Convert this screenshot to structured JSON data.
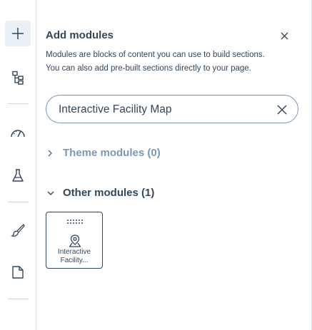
{
  "rail": {
    "items": [
      {
        "icon": "plus-icon"
      },
      {
        "icon": "tree-structure-icon"
      },
      {
        "icon": "gauge-icon"
      },
      {
        "icon": "flask-icon"
      },
      {
        "icon": "brush-icon"
      },
      {
        "icon": "page-icon"
      }
    ]
  },
  "panel": {
    "title": "Add modules",
    "description_line1": "Modules are blocks of content you can use to build sections.",
    "description_line2": "You can also add pre-built sections directly to your page."
  },
  "search": {
    "value": "Interactive Facility Map",
    "placeholder": ""
  },
  "groups": [
    {
      "label": "Theme modules (0)",
      "expanded": false
    },
    {
      "label": "Other modules (1)",
      "expanded": true
    }
  ],
  "modules": [
    {
      "label_line1": "Interactive",
      "label_line2": "Facility...",
      "icon": "map-pin-icon"
    }
  ],
  "colors": {
    "text": "#33475b",
    "muted": "#7c98b6",
    "border": "#dfe3eb",
    "active_bg": "#eaf0f6"
  }
}
